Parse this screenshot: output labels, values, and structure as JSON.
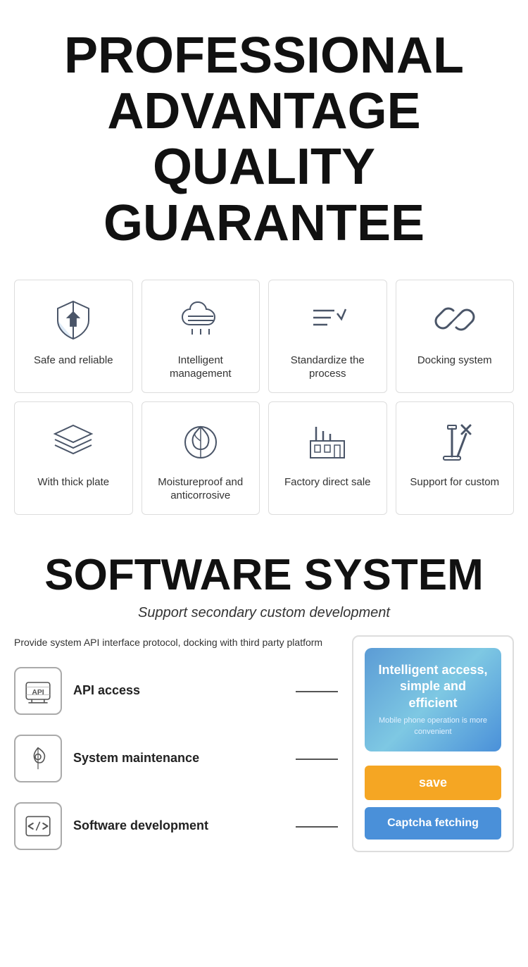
{
  "header": {
    "line1": "PROFESSIONAL",
    "line2": "ADVANTAGE",
    "line3": "QUALITY GUARANTEE"
  },
  "features": {
    "row1": [
      {
        "id": "safe-reliable",
        "label": "Safe and reliable",
        "icon": "shield"
      },
      {
        "id": "intelligent-management",
        "label": "Intelligent management",
        "icon": "cloud-settings"
      },
      {
        "id": "standardize-process",
        "label": "Standardize the process",
        "icon": "checklist"
      },
      {
        "id": "docking-system",
        "label": "Docking system",
        "icon": "link"
      }
    ],
    "row2": [
      {
        "id": "thick-plate",
        "label": "With thick plate",
        "icon": "layers"
      },
      {
        "id": "moistureproof",
        "label": "Moistureproof and anticorrosive",
        "icon": "leaf-drop"
      },
      {
        "id": "factory-direct",
        "label": "Factory direct sale",
        "icon": "factory"
      },
      {
        "id": "support-custom",
        "label": "Support for custom",
        "icon": "tools"
      }
    ]
  },
  "software": {
    "title": "SOFTWARE SYSTEM",
    "subtitle": "Support secondary custom development",
    "description": "Provide system API interface protocol, docking with third party platform",
    "items": [
      {
        "id": "api-access",
        "label": "API access",
        "icon": "api"
      },
      {
        "id": "system-maintenance",
        "label": "System maintenance",
        "icon": "wrench-drop"
      },
      {
        "id": "software-development",
        "label": "Software development",
        "icon": "code"
      }
    ],
    "panel": {
      "title": "Intelligent access, simple and efficient",
      "subtitle": "Mobile phone operation is more convenient",
      "save_label": "save",
      "captcha_label": "Captcha fetching"
    }
  }
}
